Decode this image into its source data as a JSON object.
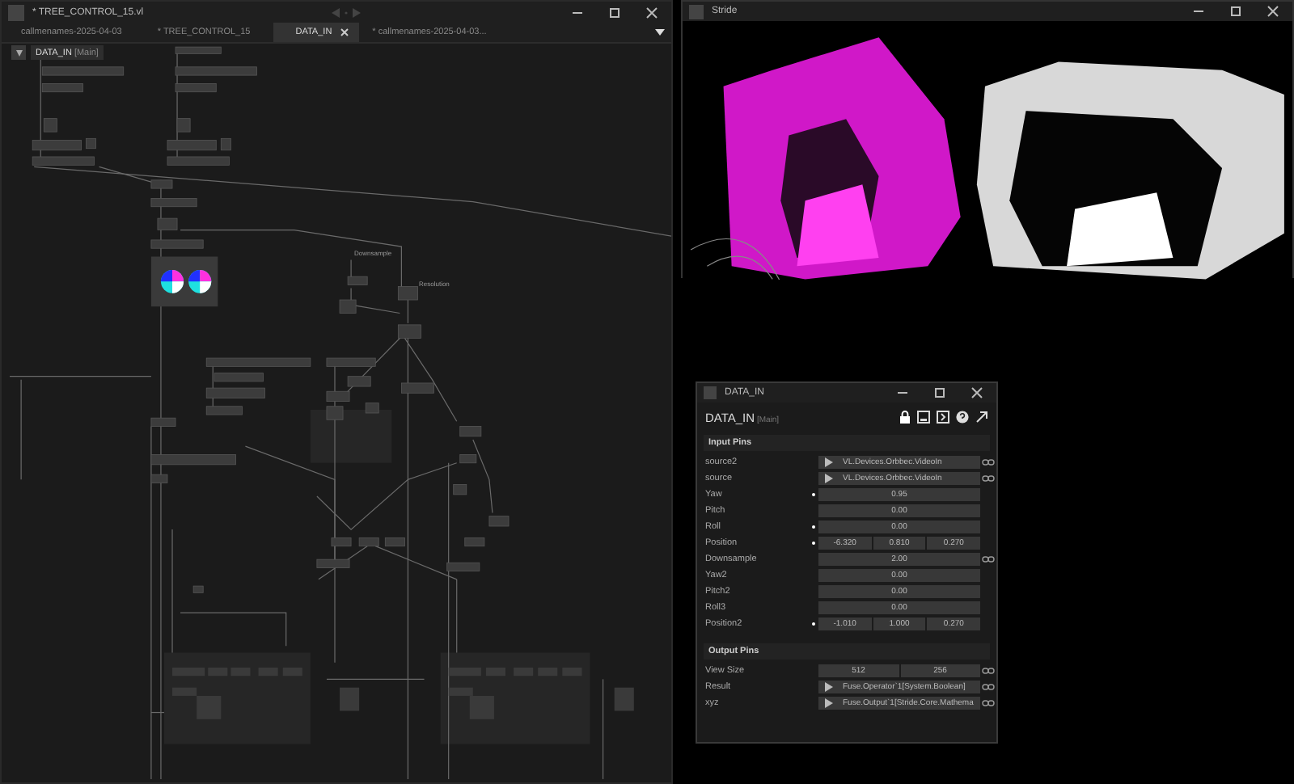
{
  "editor": {
    "title": "* TREE_CONTROL_15.vl",
    "tabs": [
      {
        "label": "callmenames-2025-04-03",
        "selected": false
      },
      {
        "label": "* TREE_CONTROL_15",
        "selected": false
      },
      {
        "label": "DATA_IN",
        "selected": true
      },
      {
        "label": "* callmenames-2025-04-03...",
        "selected": false
      }
    ],
    "breadcrumb": {
      "name": "DATA_IN",
      "suffix": "[Main]"
    },
    "graph_labels": [
      "Downsample",
      "Resolution"
    ]
  },
  "renderer": {
    "title": "Stride"
  },
  "inspector": {
    "title": "DATA_IN",
    "node": "DATA_IN",
    "suffix": "[Main]",
    "sections": [
      {
        "title": "Input Pins",
        "rows": [
          {
            "name": "source2",
            "kind": "object",
            "dot": false,
            "linked": true,
            "values": [
              "VL.Devices.Orbbec.VideoIn"
            ]
          },
          {
            "name": "source",
            "kind": "object",
            "dot": false,
            "linked": true,
            "values": [
              "VL.Devices.Orbbec.VideoIn"
            ]
          },
          {
            "name": "Yaw",
            "kind": "value",
            "dot": true,
            "linked": false,
            "values": [
              "0.95"
            ]
          },
          {
            "name": "Pitch",
            "kind": "value",
            "dot": false,
            "linked": false,
            "values": [
              "0.00"
            ]
          },
          {
            "name": "Roll",
            "kind": "value",
            "dot": true,
            "linked": false,
            "values": [
              "0.00"
            ]
          },
          {
            "name": "Position",
            "kind": "value",
            "dot": true,
            "linked": false,
            "values": [
              "-6.320",
              "0.810",
              "0.270"
            ]
          },
          {
            "name": "Downsample",
            "kind": "value",
            "dot": false,
            "linked": true,
            "values": [
              "2.00"
            ]
          },
          {
            "name": "Yaw2",
            "kind": "value",
            "dot": false,
            "linked": false,
            "values": [
              "0.00"
            ]
          },
          {
            "name": "Pitch2",
            "kind": "value",
            "dot": false,
            "linked": false,
            "values": [
              "0.00"
            ]
          },
          {
            "name": "Roll3",
            "kind": "value",
            "dot": false,
            "linked": false,
            "values": [
              "0.00"
            ]
          },
          {
            "name": "Position2",
            "kind": "value",
            "dot": true,
            "linked": false,
            "values": [
              "-1.010",
              "1.000",
              "0.270"
            ]
          }
        ]
      },
      {
        "title": "Output Pins",
        "rows": [
          {
            "name": "View Size",
            "kind": "value",
            "dot": false,
            "linked": true,
            "values": [
              "512",
              "256"
            ]
          },
          {
            "name": "Result",
            "kind": "object",
            "dot": false,
            "linked": true,
            "values": [
              "Fuse.Operator`1[System.Boolean]"
            ]
          },
          {
            "name": "xyz",
            "kind": "object",
            "dot": false,
            "linked": true,
            "values": [
              "Fuse.Output`1[Stride.Core.Mathema"
            ]
          }
        ]
      }
    ]
  }
}
